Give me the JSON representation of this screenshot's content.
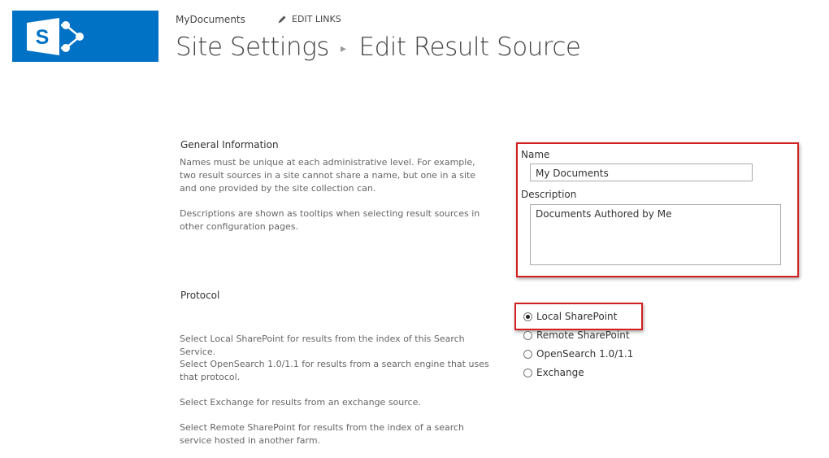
{
  "header": {
    "site_link": "MyDocuments",
    "edit_links": "EDIT LINKS",
    "title_parent": "Site Settings",
    "title_current": "Edit Result Source"
  },
  "general": {
    "heading": "General Information",
    "desc1": "Names must be unique at each administrative level. For example, two result sources in a site cannot share a name, but one in a site and one provided by the site collection can.",
    "desc2": "Descriptions are shown as tooltips when selecting result sources in other configuration pages.",
    "name_label": "Name",
    "name_value": "My Documents",
    "description_label": "Description",
    "description_value": "Documents Authored by Me"
  },
  "protocol": {
    "heading": "Protocol",
    "desc1": "Select Local SharePoint for results from the index of this Search Service.",
    "desc2": "Select OpenSearch 1.0/1.1 for results from a search engine that uses that protocol.",
    "desc3": "Select Exchange for results from an exchange source.",
    "desc4": "Select Remote SharePoint for results from the index of a search service hosted in another farm.",
    "options": [
      {
        "label": "Local SharePoint",
        "selected": true
      },
      {
        "label": "Remote SharePoint",
        "selected": false
      },
      {
        "label": "OpenSearch 1.0/1.1",
        "selected": false
      },
      {
        "label": "Exchange",
        "selected": false
      }
    ]
  },
  "colors": {
    "brand": "#0072c6",
    "highlight": "#d21f1f"
  }
}
